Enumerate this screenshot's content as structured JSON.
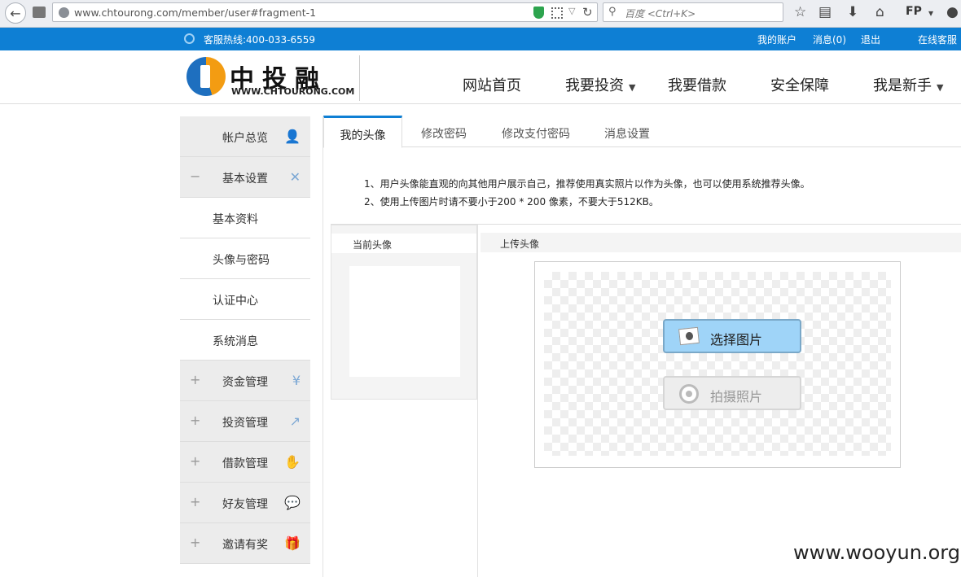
{
  "browser": {
    "url": "www.chtourong.com/member/user#fragment-1",
    "search_placeholder": "百度 <Ctrl+K>",
    "profile_label": "FP"
  },
  "topbar": {
    "hotline": "客服热线:400-033-6559",
    "my_account": "我的账户",
    "messages": "消息(0)",
    "logout": "退出",
    "online_service": "在线客服"
  },
  "logo": {
    "cn": "中投融",
    "en": "WWW.CHTOURONG.COM"
  },
  "nav": [
    {
      "label": "网站首页",
      "dropdown": false
    },
    {
      "label": "我要投资",
      "dropdown": true
    },
    {
      "label": "我要借款",
      "dropdown": false
    },
    {
      "label": "安全保障",
      "dropdown": false
    },
    {
      "label": "我是新手",
      "dropdown": true
    }
  ],
  "sidebar": {
    "items": [
      {
        "label": "帐户总览",
        "prefix": "",
        "icon": "user-icon"
      },
      {
        "label": "基本设置",
        "prefix": "−",
        "icon": "tools-icon"
      },
      {
        "label": "基本资料",
        "prefix": "",
        "icon": ""
      },
      {
        "label": "头像与密码",
        "prefix": "",
        "icon": ""
      },
      {
        "label": "认证中心",
        "prefix": "",
        "icon": ""
      },
      {
        "label": "系统消息",
        "prefix": "",
        "icon": ""
      },
      {
        "label": "资金管理",
        "prefix": "+",
        "icon": "yen-icon"
      },
      {
        "label": "投资管理",
        "prefix": "+",
        "icon": "chart-icon"
      },
      {
        "label": "借款管理",
        "prefix": "+",
        "icon": "hand-icon"
      },
      {
        "label": "好友管理",
        "prefix": "+",
        "icon": "chat-icon"
      },
      {
        "label": "邀请有奖",
        "prefix": "+",
        "icon": "gift-icon"
      }
    ]
  },
  "tabs": [
    {
      "label": "我的头像",
      "active": true
    },
    {
      "label": "修改密码",
      "active": false
    },
    {
      "label": "修改支付密码",
      "active": false
    },
    {
      "label": "消息设置",
      "active": false
    }
  ],
  "notes": [
    "1、用户头像能直观的向其他用户展示自己，推荐使用真实照片以作为头像，也可以使用系统推荐头像。",
    "2、使用上传图片时请不要小于200 * 200 像素，不要大于512KB。"
  ],
  "avatar_panel": {
    "current_title": "当前头像",
    "upload_title": "上传头像",
    "choose_button": "选择图片",
    "photo_button": "拍摄照片"
  },
  "watermark": "www.wooyun.org",
  "colors": {
    "brand_blue": "#0e7fd4",
    "choose_button_bg": "#9fd4f8"
  }
}
